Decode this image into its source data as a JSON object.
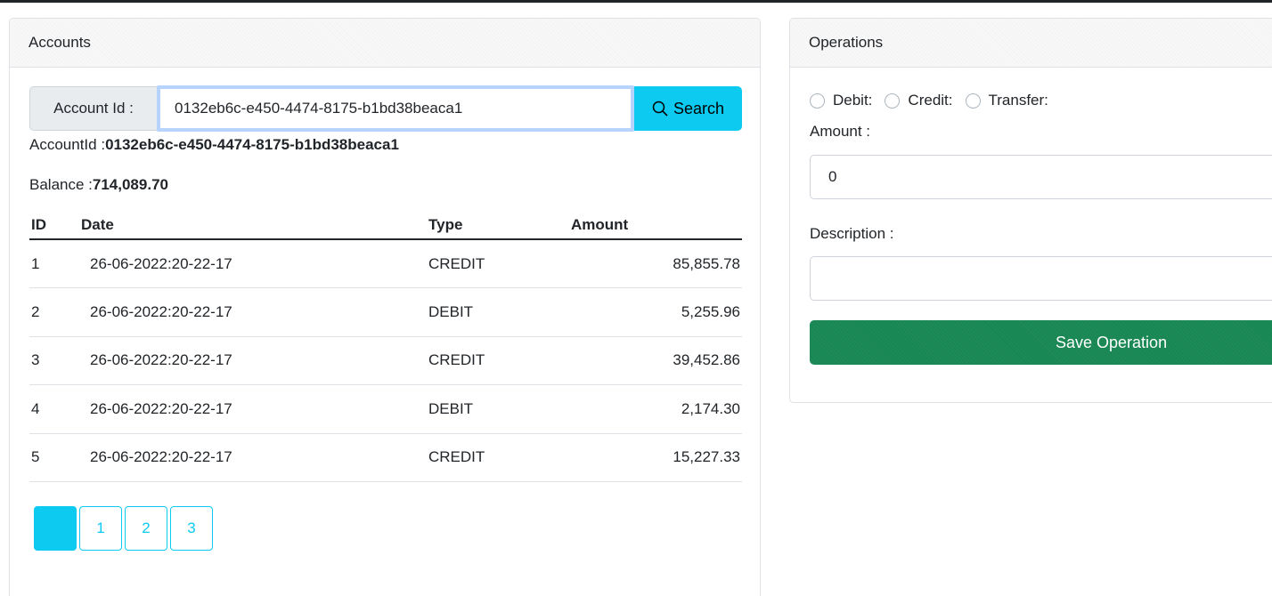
{
  "accounts": {
    "header": "Accounts",
    "account_id_label": "Account Id :",
    "account_id_value": "0132eb6c-e450-4474-8175-b1bd38beaca1",
    "search_label": "Search",
    "accountid_prefix": "AccountId :",
    "accountid_value": "0132eb6c-e450-4474-8175-b1bd38beaca1",
    "balance_prefix": "Balance :",
    "balance_value": "714,089.70",
    "table": {
      "headers": [
        "ID",
        "Date",
        "Type",
        "Amount"
      ],
      "rows": [
        {
          "id": "1",
          "date": "26-06-2022:20-22-17",
          "type": "CREDIT",
          "amount": "85,855.78"
        },
        {
          "id": "2",
          "date": "26-06-2022:20-22-17",
          "type": "DEBIT",
          "amount": "5,255.96"
        },
        {
          "id": "3",
          "date": "26-06-2022:20-22-17",
          "type": "CREDIT",
          "amount": "39,452.86"
        },
        {
          "id": "4",
          "date": "26-06-2022:20-22-17",
          "type": "DEBIT",
          "amount": "2,174.30"
        },
        {
          "id": "5",
          "date": "26-06-2022:20-22-17",
          "type": "CREDIT",
          "amount": "15,227.33"
        }
      ]
    },
    "pages": [
      "",
      "1",
      "2",
      "3"
    ]
  },
  "operations": {
    "header": "Operations",
    "radios": [
      "Debit:",
      "Credit:",
      "Transfer:"
    ],
    "amount_label": "Amount :",
    "amount_value": "0",
    "description_label": "Description :",
    "description_value": "",
    "save_label": "Save Operation"
  },
  "colors": {
    "search_button": "#0dcaf0",
    "save_button": "#198754",
    "pagination": "#0dcaf0"
  }
}
